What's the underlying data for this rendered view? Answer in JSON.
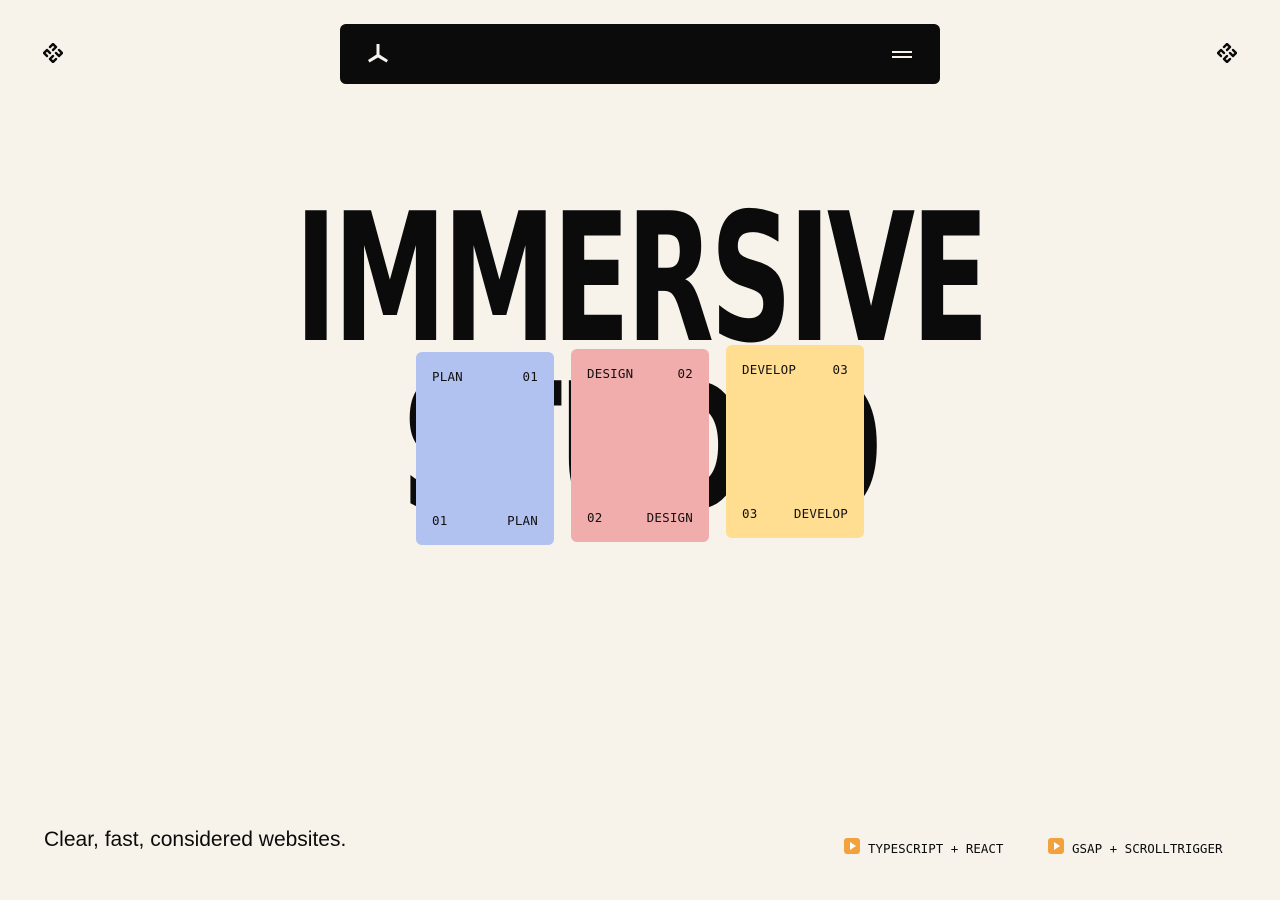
{
  "header": {
    "left_icon": "rotating-diamond-icon",
    "right_icon": "rotating-diamond-icon",
    "logo_icon": "tri-blade-logo-icon",
    "menu_icon": "hamburger-menu-icon"
  },
  "hero": {
    "headline_line1": "IMMERSIVE",
    "headline_line2": "STUDIO"
  },
  "cards": [
    {
      "title": "PLAN",
      "number": "01",
      "color": "#b1c1f0"
    },
    {
      "title": "DESIGN",
      "number": "02",
      "color": "#f1acac"
    },
    {
      "title": "DEVELOP",
      "number": "03",
      "color": "#ffdd91"
    }
  ],
  "footer": {
    "tagline": "Clear, fast, considered websites.",
    "tech": [
      {
        "icon": "play-button-icon",
        "label": "TYPESCRIPT + REACT"
      },
      {
        "icon": "play-button-icon",
        "label": "GSAP + SCROLLTRIGGER"
      }
    ]
  },
  "colors": {
    "background": "#f7f2ea",
    "ink": "#0b0b0b",
    "accent_play": "#f2a23c"
  }
}
